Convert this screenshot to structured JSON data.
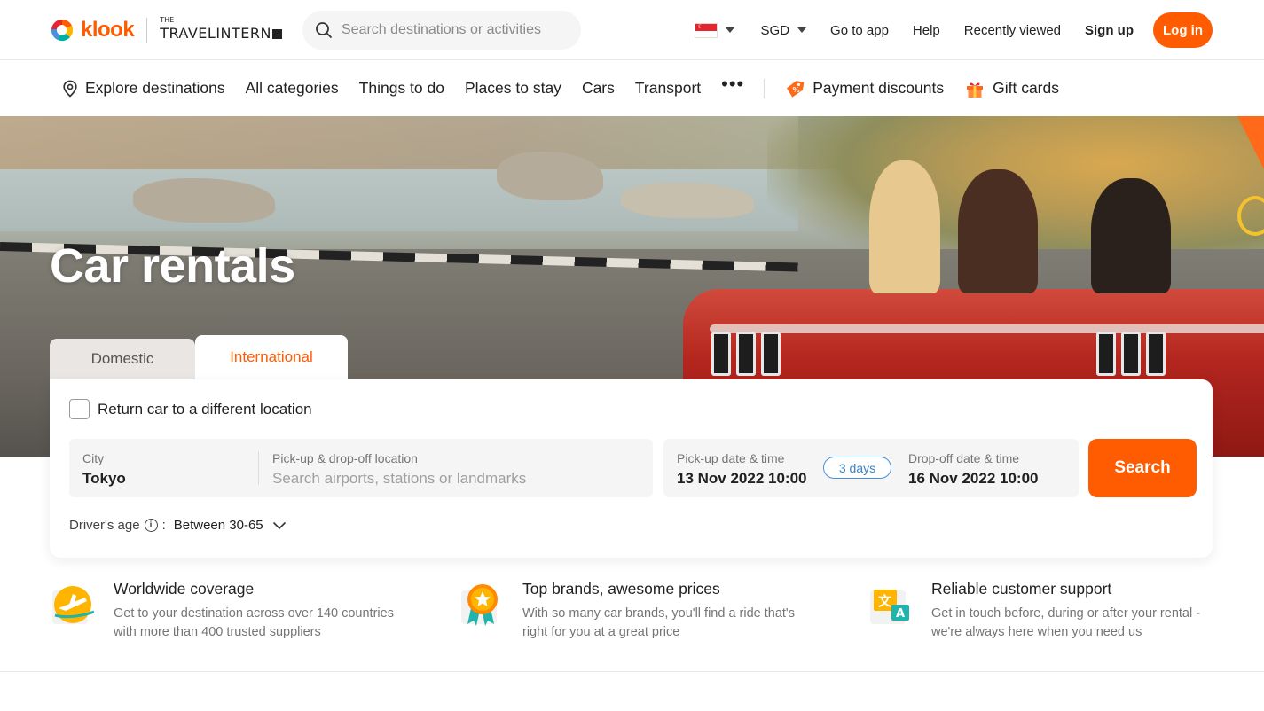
{
  "header": {
    "brand": "klook",
    "partner_small": "THE",
    "partner": "TRAVELINTERN",
    "search_placeholder": "Search destinations or activities",
    "currency": "SGD",
    "go_to_app": "Go to app",
    "help": "Help",
    "recently_viewed": "Recently viewed",
    "sign_up": "Sign up",
    "log_in": "Log in",
    "accent_color": "#ff5b00"
  },
  "subnav": {
    "explore": "Explore destinations",
    "all_categories": "All categories",
    "things_to_do": "Things to do",
    "places_to_stay": "Places to stay",
    "cars": "Cars",
    "transport": "Transport",
    "more": "•••",
    "payment_discounts": "Payment discounts",
    "gift_cards": "Gift cards"
  },
  "hero": {
    "title": "Car rentals"
  },
  "tabs": [
    {
      "label": "Domestic",
      "active": false
    },
    {
      "label": "International",
      "active": true
    }
  ],
  "form": {
    "return_checkbox_label": "Return car to a different location",
    "return_checked": false,
    "city_label": "City",
    "city_value": "Tokyo",
    "location_label": "Pick-up & drop-off location",
    "location_placeholder": "Search airports, stations or landmarks",
    "pickup_label": "Pick-up date & time",
    "pickup_value": "13 Nov 2022 10:00",
    "duration": "3 days",
    "dropoff_label": "Drop-off date & time",
    "dropoff_value": "16 Nov 2022 10:00",
    "search_button": "Search",
    "driver_age_label": "Driver's age",
    "driver_age_sep": ":",
    "driver_age_value": "Between 30-65"
  },
  "features": [
    {
      "icon": "airplane-globe-icon",
      "title": "Worldwide coverage",
      "desc": "Get to your destination across over 140 countries with more than 400 trusted suppliers"
    },
    {
      "icon": "award-medal-icon",
      "title": "Top brands, awesome prices",
      "desc": "With so many car brands, you'll find a ride that's right for you at a great price"
    },
    {
      "icon": "translate-icon",
      "title": "Reliable customer support",
      "desc": "Get in touch before, during or after your rental - we're always here when you need us"
    }
  ]
}
